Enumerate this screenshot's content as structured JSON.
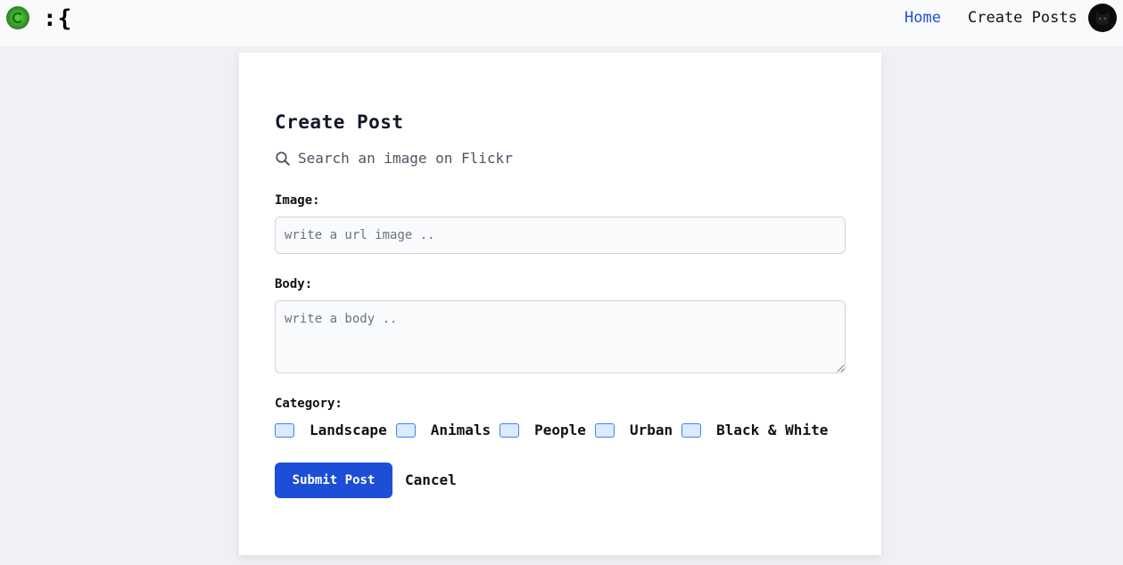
{
  "header": {
    "brand": ":{",
    "nav": {
      "home": "Home",
      "create_posts": "Create Posts"
    }
  },
  "form": {
    "title": "Create Post",
    "flickr_search_placeholder": "Search an image on Flickr",
    "image_label": "Image:",
    "image_placeholder": "write a url image ..",
    "body_label": "Body:",
    "body_placeholder": "write a body ..",
    "category_label": "Category:",
    "categories": [
      "Landscape",
      "Animals",
      "People",
      "Urban",
      "Black & White"
    ],
    "submit_label": "Submit Post",
    "cancel_label": "Cancel"
  },
  "colors": {
    "accent": "#1d4ed8",
    "page_bg": "#eff1f4",
    "card_bg": "#ffffff"
  },
  "icons": {
    "logo": "green-swirl-logo-icon",
    "avatar": "dark-cat-avatar-icon",
    "search": "search-icon"
  }
}
